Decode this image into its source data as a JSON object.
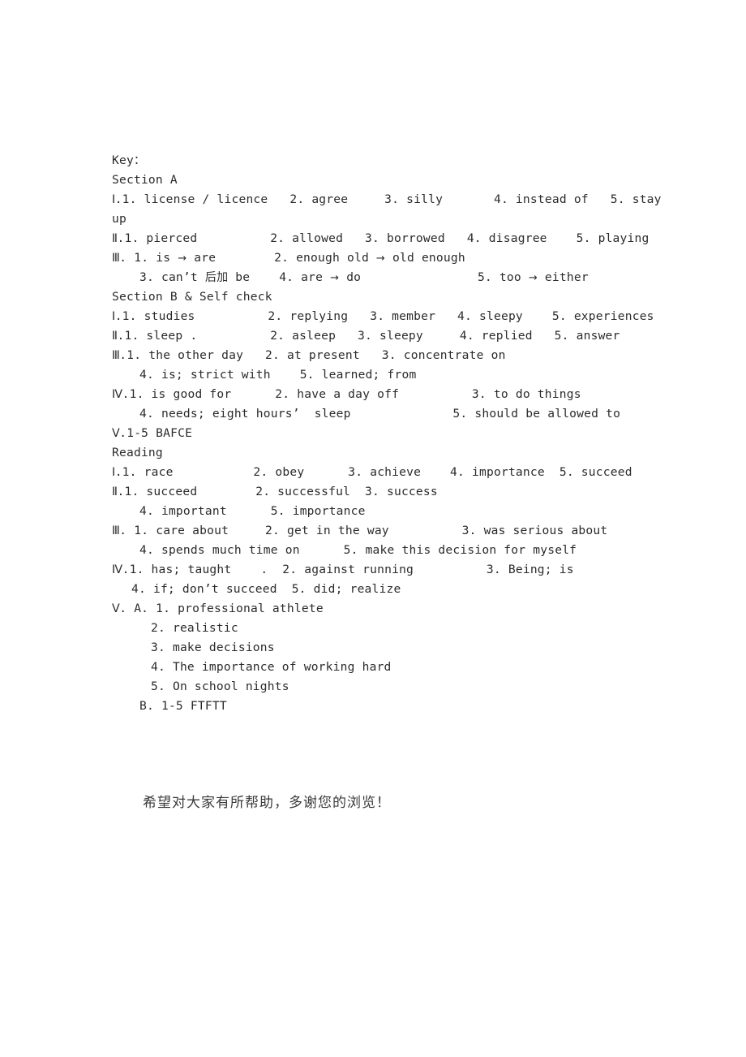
{
  "document": {
    "title": "Key:",
    "lines": [
      {
        "id": "key-heading",
        "indent": 1,
        "text": "Key："
      },
      {
        "id": "section-a-heading",
        "indent": 1,
        "text": "Section A"
      },
      {
        "id": "sec-a-1-line1",
        "indent": 1,
        "text": "Ⅰ.1. license / licence   2. agree     3. silly       4. instead of   5. stay"
      },
      {
        "id": "sec-a-1-line2",
        "indent": 1,
        "text": "up"
      },
      {
        "id": "sec-a-2-line1",
        "indent": 1,
        "text": "Ⅱ.1. pierced          2. allowed   3. borrowed   4. disagree    5. playing"
      },
      {
        "id": "sec-a-3-line1",
        "indent": 1,
        "text": "Ⅲ. 1. is → are        2. enough old → old enough"
      },
      {
        "id": "sec-a-3-line2",
        "indent": 3,
        "text": "3. can’t 后加 be    4. are → do                5. too → either"
      },
      {
        "id": "section-b-heading",
        "indent": 1,
        "text": "Section B & Self check"
      },
      {
        "id": "sec-b-1-line1",
        "indent": 1,
        "text": "Ⅰ.1. studies          2. replying   3. member   4. sleepy    5. experiences"
      },
      {
        "id": "sec-b-2-line1",
        "indent": 1,
        "text": "Ⅱ.1. sleep .          2. asleep   3. sleepy     4. replied   5. answer"
      },
      {
        "id": "sec-b-3-line1",
        "indent": 1,
        "text": "Ⅲ.1. the other day   2. at present   3. concentrate on"
      },
      {
        "id": "sec-b-3-line2",
        "indent": 3,
        "text": "4. is; strict with    5. learned; from"
      },
      {
        "id": "sec-b-4-line1",
        "indent": 1,
        "text": "Ⅳ.1. is good for      2. have a day off          3. to do things"
      },
      {
        "id": "sec-b-4-line2",
        "indent": 3,
        "text": "4. needs; eight hours’  sleep              5. should be allowed to"
      },
      {
        "id": "sec-b-5-line1",
        "indent": 1,
        "text": "Ⅴ.1-5 BAFCE"
      },
      {
        "id": "reading-heading",
        "indent": 1,
        "text": "Reading"
      },
      {
        "id": "read-1-line1",
        "indent": 1,
        "text": "Ⅰ.1. race           2. obey      3. achieve    4. importance  5. succeed"
      },
      {
        "id": "read-2-line1",
        "indent": 1,
        "text": "Ⅱ.1. succeed        2. successful  3. success"
      },
      {
        "id": "read-2-line2",
        "indent": 3,
        "text": "4. important      5. importance"
      },
      {
        "id": "read-3-line1",
        "indent": 1,
        "text": "Ⅲ. 1. care about     2. get in the way          3. was serious about"
      },
      {
        "id": "read-3-line2",
        "indent": 3,
        "text": "4. spends much time on      5. make this decision for myself"
      },
      {
        "id": "read-4-line1",
        "indent": 1,
        "text": "Ⅳ.1. has; taught    .  2. against running          3. Being; is"
      },
      {
        "id": "read-4-line2",
        "indent": 2,
        "text": "4. if; don’t succeed  5. did; realize"
      },
      {
        "id": "read-5-a-1",
        "indent": 1,
        "text": "Ⅴ. A. 1. professional athlete"
      },
      {
        "id": "read-5-a-2",
        "indent": 4,
        "text": "2. realistic"
      },
      {
        "id": "read-5-a-3",
        "indent": 4,
        "text": "3. make decisions"
      },
      {
        "id": "read-5-a-4",
        "indent": 4,
        "text": "4. The importance of working hard"
      },
      {
        "id": "read-5-a-5",
        "indent": 4,
        "text": "5. On school nights"
      },
      {
        "id": "read-5-b",
        "indent": 3,
        "text": "B. 1-5 FTFTT"
      }
    ],
    "footer": "希望对大家有所帮助，多谢您的浏览！"
  }
}
